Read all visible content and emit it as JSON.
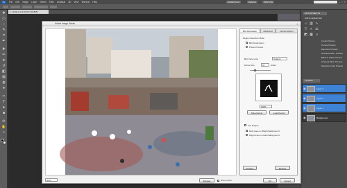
{
  "app": {
    "logo": "Ps",
    "menu": [
      "File",
      "Edit",
      "Image",
      "Layer",
      "Select",
      "Filter",
      "Analysis",
      "3D",
      "View",
      "Window",
      "Help"
    ],
    "workspace_buttons": [
      "ESSENTIALS",
      "DESIGN",
      "PAINTING"
    ],
    "window_controls": [
      "–",
      "□",
      "×"
    ]
  },
  "document": {
    "tab_label": "1_Untitled-1 @ 100% (RGB/8)"
  },
  "dialog": {
    "title": "Adobe Image Deblur",
    "close": "×",
    "tabs": [
      "Blur Estimation",
      "Advanced",
      "Deconvolution"
    ],
    "section_title": "Region Selection Mode",
    "mode_options": [
      "Blind Estimation",
      "Preset Preview"
    ],
    "blur_level_label": "Blur trace level",
    "blur_level_value": "Custom",
    "kernel_size_label": "Kernel size",
    "kernel_size_value": "31",
    "kernel_unit": "pixels",
    "zoom_value": "100%",
    "save_kernel": "Save Kernel",
    "load_kernel": "Load Kernel",
    "use_region": "Use Region",
    "region_options": [
      "Dark trace on Bright Background",
      "Bright trace on Dark Background"
    ],
    "bottom_zoom": "30%",
    "preview_label": "Show result",
    "buttons": {
      "preview": "Preview",
      "ok": "OK",
      "cancel": "Cancel",
      "restore": "Restore",
      "analyze": "Analyze"
    }
  },
  "panels": {
    "adjustments_tab": "ADJUSTMENTS",
    "add_adjustment": "Add an adjustment",
    "presets": [
      "Levels Presets",
      "Curves Presets",
      "Exposure Presets",
      "Hue/Saturation Presets",
      "Black & White Presets",
      "Channel Mixer Presets",
      "Selective Color Presets"
    ],
    "layers_tab": "LAYERS",
    "layers": [
      "Layer 3",
      "Layer 2",
      "Layer 1",
      "Background"
    ]
  }
}
